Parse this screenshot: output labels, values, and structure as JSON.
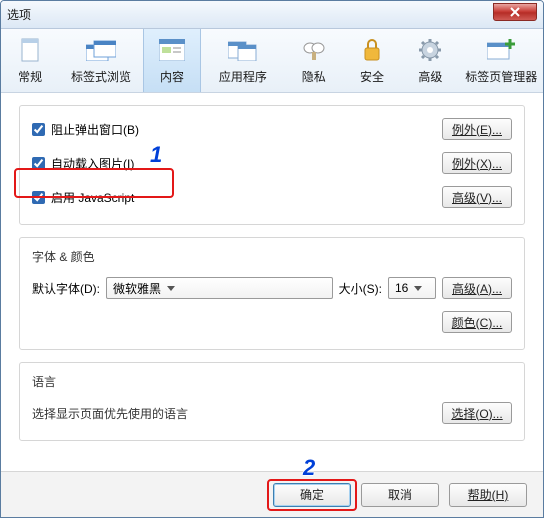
{
  "window": {
    "title": "选项"
  },
  "toolbar": {
    "general": "常规",
    "tabs": "标签式浏览",
    "content": "内容",
    "applications": "应用程序",
    "privacy": "隐私",
    "security": "安全",
    "advanced": "高级",
    "tabmanager": "标签页管理器"
  },
  "content": {
    "block_popups": "阻止弹出窗口(B)",
    "autoload_images": "自动载入图片(I)",
    "enable_js": "启用 JavaScript",
    "btn_exceptions_e": "例外(E)...",
    "btn_exceptions_x": "例外(X)...",
    "btn_advanced_v": "高级(V)..."
  },
  "fonts": {
    "legend": "字体 & 颜色",
    "default_font_label": "默认字体(D):",
    "default_font_value": "微软雅黑",
    "size_label": "大小(S):",
    "size_value": "16",
    "btn_advanced_a": "高级(A)...",
    "btn_colors_c": "颜色(C)..."
  },
  "lang": {
    "legend": "语言",
    "desc": "选择显示页面优先使用的语言",
    "btn_choose_o": "选择(O)..."
  },
  "footer": {
    "ok": "确定",
    "cancel": "取消",
    "help": "帮助(H)"
  },
  "annotations": {
    "one": "1",
    "two": "2"
  }
}
